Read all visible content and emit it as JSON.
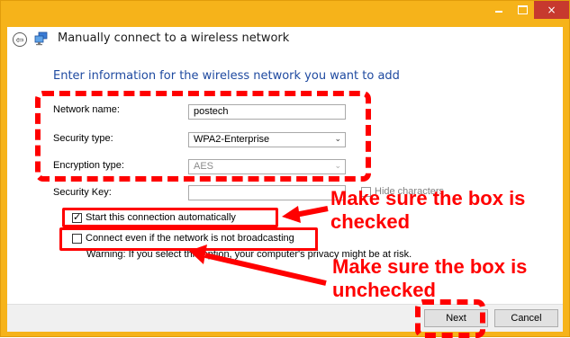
{
  "window": {
    "title": "Manually connect to a wireless network",
    "accent": "#f6b31a",
    "close_color": "#c7392e",
    "caption": {
      "minimize_glyph": "minimize-icon",
      "maximize_glyph": "maximize-icon",
      "close_glyph": "×"
    }
  },
  "nav": {
    "back_glyph": "⇦"
  },
  "form": {
    "instruction": "Enter information for the wireless network you want to add",
    "network_name_label": "Network name:",
    "network_name_value": "postech",
    "security_type_label": "Security type:",
    "security_type_value": "WPA2-Enterprise",
    "encryption_type_label": "Encryption type:",
    "encryption_type_value": "AES",
    "security_key_label": "Security Key:",
    "security_key_value": "",
    "hide_characters_label": "Hide characters",
    "start_automatically_label": "Start this connection automatically",
    "start_automatically_checked": true,
    "connect_not_broadcasting_label": "Connect even if the network is not broadcasting",
    "connect_not_broadcasting_checked": false,
    "warning": "Warning: If you select this option, your computer's privacy might be at risk.",
    "dropdown_arrow": "⌄"
  },
  "buttons": {
    "next": "Next",
    "cancel": "Cancel"
  },
  "annotations": {
    "checked_note": "Make sure the box is\nchecked",
    "unchecked_note": "Make sure the box is\nunchecked",
    "color": "#ff0000"
  }
}
